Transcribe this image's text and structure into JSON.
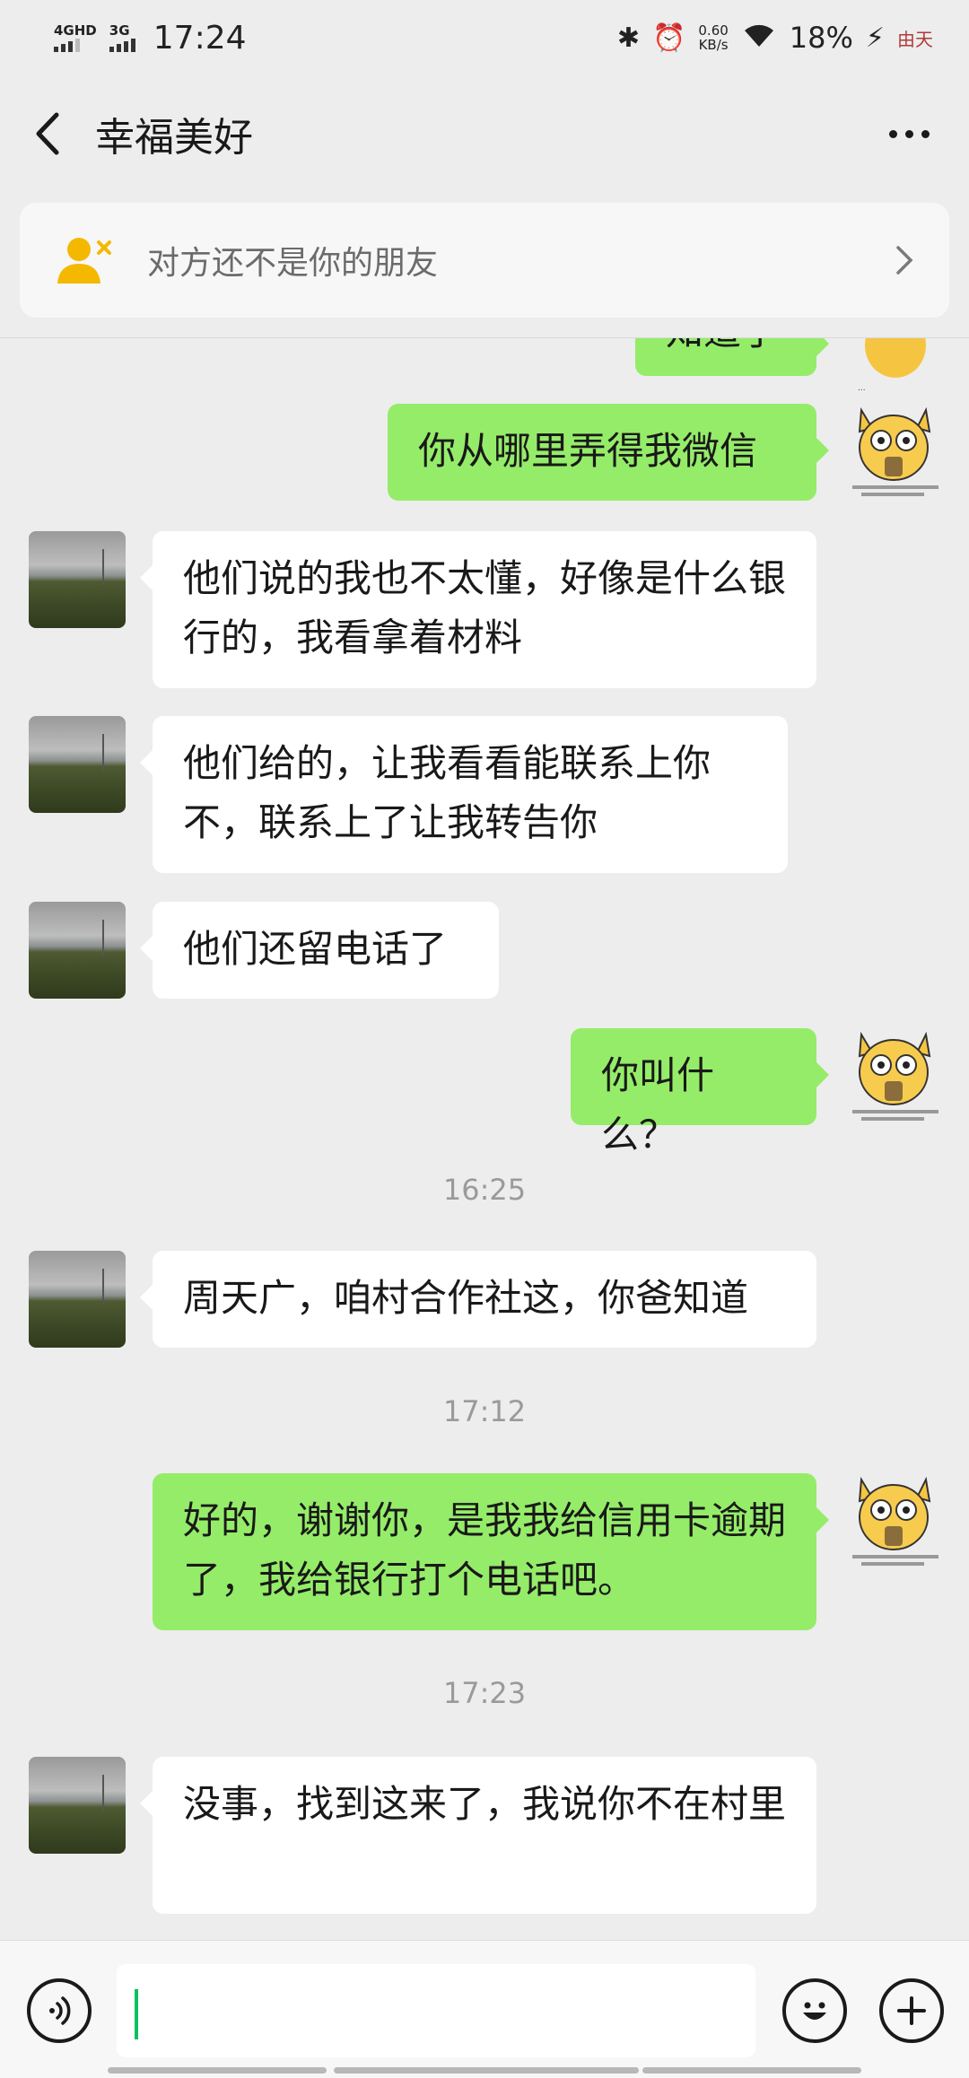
{
  "status_bar": {
    "network1": "4GHD",
    "network2": "3G",
    "time": "17:24",
    "speed_value": "0.60",
    "speed_unit": "KB/s",
    "battery": "18%",
    "watermark": "由天"
  },
  "header": {
    "title": "幸福美好"
  },
  "banner": {
    "text": "对方还不是你的朋友"
  },
  "messages": [
    {
      "dir": "out",
      "text": "知道了"
    },
    {
      "dir": "out",
      "text": "你从哪里弄得我微信"
    },
    {
      "dir": "in",
      "text": "他们说的我也不太懂，好像是什么银行的，我看拿着材料"
    },
    {
      "dir": "in",
      "text": "他们给的，让我看看能联系上你不，联系上了让我转告你"
    },
    {
      "dir": "in",
      "text": "他们还留电话了"
    },
    {
      "dir": "out",
      "text": "你叫什么？"
    },
    {
      "dir": "time",
      "text": "16:25"
    },
    {
      "dir": "in",
      "text": "周天广，咱村合作社这，你爸知道"
    },
    {
      "dir": "time",
      "text": "17:12"
    },
    {
      "dir": "out",
      "text": "好的，谢谢你，是我我给信用卡逾期了，我给银行打个电话吧。"
    },
    {
      "dir": "time",
      "text": "17:23"
    },
    {
      "dir": "in",
      "text": "没事，找到这来了，我说你不在村里"
    }
  ],
  "input": {
    "value": "",
    "placeholder": ""
  },
  "colors": {
    "outgoing_bubble": "#95ec69",
    "incoming_bubble": "#ffffff",
    "background": "#ededed",
    "accent": "#07c160"
  },
  "icons": [
    "back-arrow-icon",
    "more-icon",
    "add-friend-icon",
    "chevron-right-icon",
    "voice-icon",
    "emoji-icon",
    "plus-icon"
  ]
}
